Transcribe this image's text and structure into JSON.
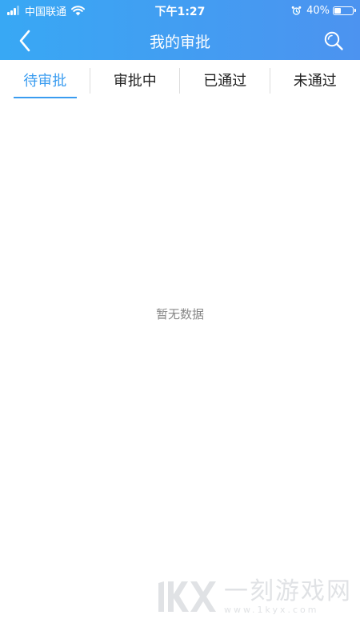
{
  "status_bar": {
    "carrier": "中国联通",
    "time": "下午1:27",
    "battery_percent": "40%",
    "battery_level": 0.4,
    "signal_bars": 3,
    "icons": [
      "signal-icon",
      "wifi-icon",
      "alarm-icon",
      "battery-icon"
    ]
  },
  "nav": {
    "title": "我的审批",
    "back_icon": "chevron-left-icon",
    "search_icon": "search-icon"
  },
  "tabs": [
    {
      "label": "待审批",
      "active": true
    },
    {
      "label": "审批中",
      "active": false
    },
    {
      "label": "已通过",
      "active": false
    },
    {
      "label": "未通过",
      "active": false
    }
  ],
  "content": {
    "empty_text": "暂无数据"
  },
  "watermark": {
    "text": "一刻游戏网",
    "url": "www.1kyx.com"
  },
  "colors": {
    "header_start": "#38a8f4",
    "header_end": "#4c93f0",
    "accent": "#3a9cf0",
    "empty_text": "#888888"
  }
}
